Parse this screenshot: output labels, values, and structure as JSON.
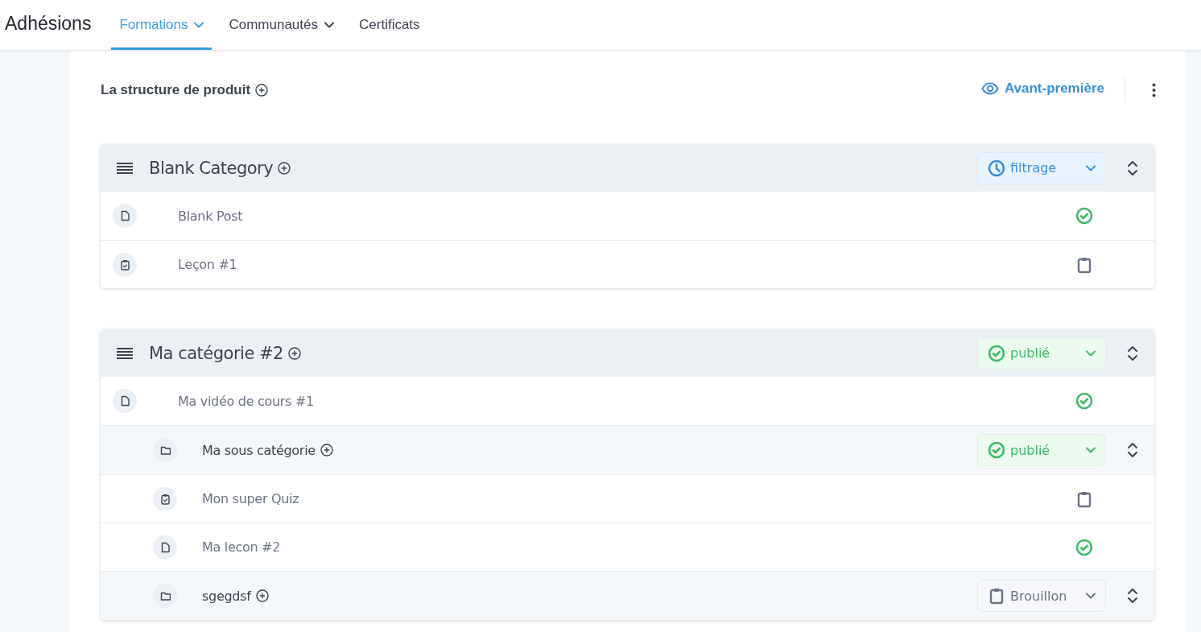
{
  "app_title": "Adhésions",
  "tabs": [
    {
      "label": "Formations",
      "selected": true,
      "has_menu": true
    },
    {
      "label": "Communautés",
      "selected": false,
      "has_menu": true
    },
    {
      "label": "Certificats",
      "selected": false,
      "has_menu": false
    }
  ],
  "panel": {
    "title": "La structure de produit",
    "preview_label": "Avant-première"
  },
  "categories": [
    {
      "title": "Blank Category",
      "status": {
        "kind": "scheduled",
        "label": "filtrage"
      },
      "children": [
        {
          "kind": "document",
          "title": "Blank Post",
          "published": true
        },
        {
          "kind": "quiz",
          "title": "Leçon #1",
          "published": false
        }
      ]
    },
    {
      "title": "Ma catégorie #2",
      "status": {
        "kind": "published",
        "label": "publié"
      },
      "children": [
        {
          "kind": "document",
          "title": "Ma vidéo de cours #1",
          "published": true
        },
        {
          "kind": "subcategory",
          "title": "Ma sous catégorie",
          "status": {
            "kind": "published",
            "label": "publié"
          },
          "children": [
            {
              "kind": "quiz",
              "title": "Mon super Quiz",
              "published": false
            },
            {
              "kind": "document",
              "title": "Ma lecon #2",
              "published": true
            }
          ]
        },
        {
          "kind": "subcategory",
          "title": "sgegdsf",
          "status": {
            "kind": "draft",
            "label": "Brouillon"
          }
        }
      ]
    }
  ]
}
